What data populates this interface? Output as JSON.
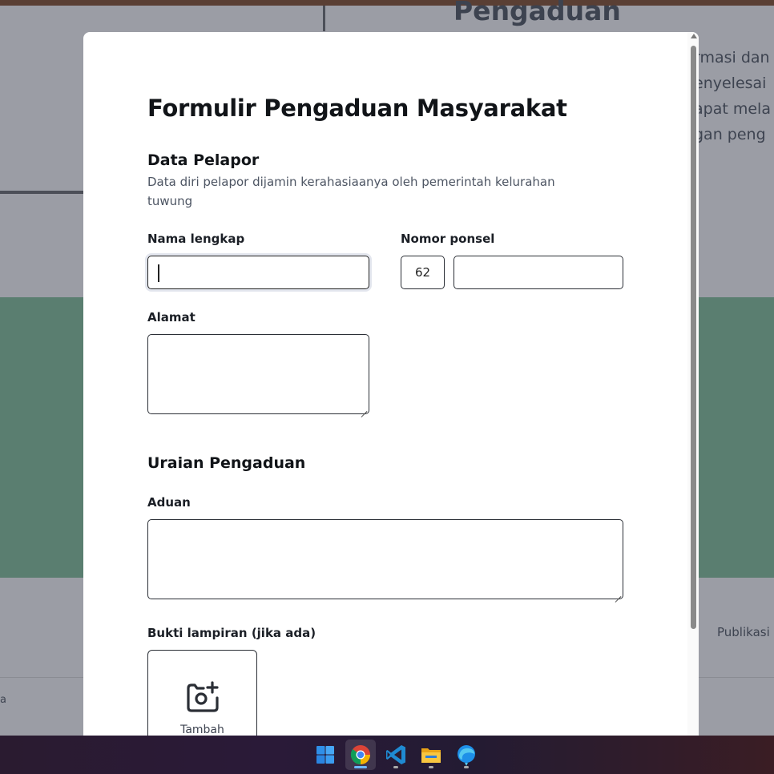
{
  "background_page": {
    "title": "Pengaduan",
    "paragraph_lines": [
      "rmasi dan",
      "enyelesai",
      "apat mela",
      "gan peng"
    ],
    "footer_link": "Publikasi",
    "footer_fragment": "a"
  },
  "modal": {
    "title": "Formulir Pengaduan Masyarakat",
    "reporter_section": {
      "heading": "Data Pelapor",
      "description": "Data diri pelapor dijamin kerahasiaanya oleh pemerintah kelurahan tuwung",
      "full_name": {
        "label": "Nama lengkap",
        "value": ""
      },
      "phone": {
        "label": "Nomor ponsel",
        "country_code": "62",
        "value": ""
      },
      "address": {
        "label": "Alamat",
        "value": ""
      }
    },
    "complaint_section": {
      "heading": "Uraian Pengaduan",
      "complaint": {
        "label": "Aduan",
        "value": ""
      },
      "attachment": {
        "label": "Bukti lampiran (jika ada)",
        "add_label": "Tambah",
        "icon": "camera-add-icon"
      }
    }
  },
  "taskbar": {
    "items": [
      {
        "name": "windows-start-icon",
        "active": false
      },
      {
        "name": "chrome-icon",
        "active": true
      },
      {
        "name": "vscode-icon",
        "active": false
      },
      {
        "name": "file-explorer-icon",
        "active": false
      },
      {
        "name": "edge-icon",
        "active": false
      }
    ]
  },
  "colors": {
    "modal_bg": "#ffffff",
    "overlay_bg": "#9b9da5",
    "green_band": "#5a7e70",
    "text_primary": "#111418",
    "border": "#2b2f36"
  }
}
